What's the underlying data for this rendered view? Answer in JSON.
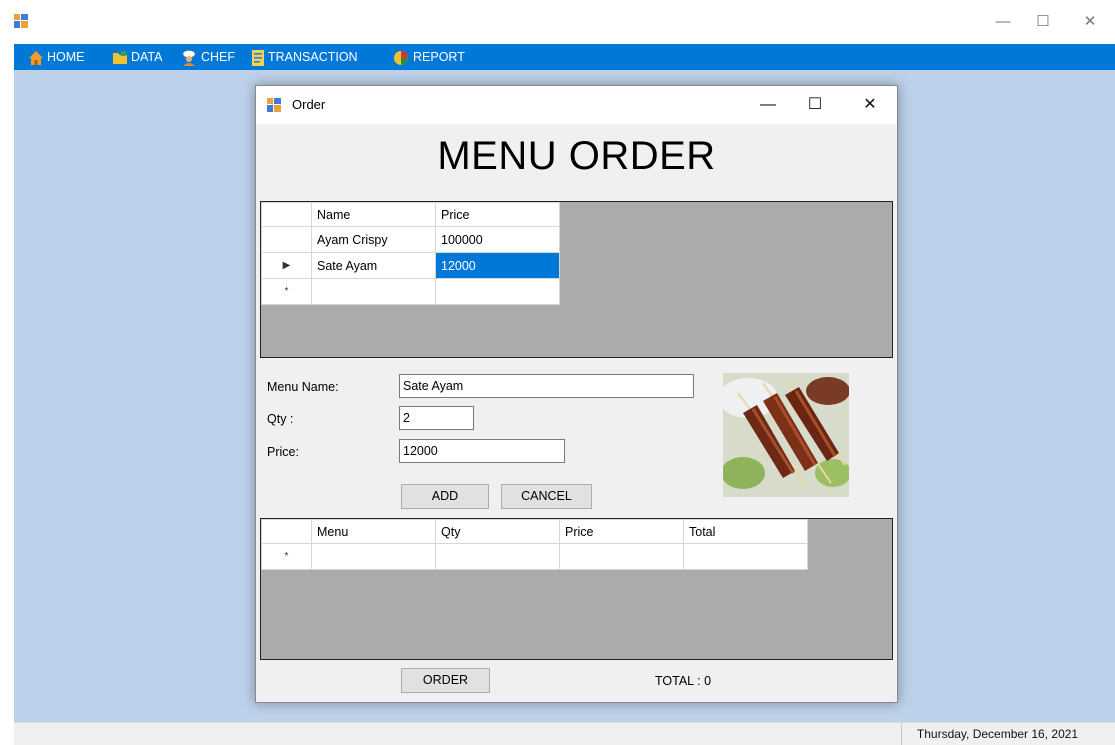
{
  "main_window": {
    "minimize_glyph": "—",
    "maximize_glyph": "☐",
    "close_glyph": "✕"
  },
  "menubar": {
    "items": [
      {
        "label": "HOME",
        "icon": "home-icon"
      },
      {
        "label": "DATA",
        "icon": "folder-icon"
      },
      {
        "label": "CHEF",
        "icon": "chef-icon"
      },
      {
        "label": "TRANSACTION",
        "icon": "transaction-icon"
      },
      {
        "label": "REPORT",
        "icon": "report-icon"
      }
    ]
  },
  "order_window": {
    "title": "Order",
    "minimize_glyph": "—",
    "maximize_glyph": "☐",
    "close_glyph": "✕",
    "heading": "MENU ORDER",
    "menu_grid": {
      "columns": [
        "Name",
        "Price"
      ],
      "rows": [
        {
          "marker": "",
          "name": "Ayam Crispy",
          "price": "100000"
        },
        {
          "marker": "▶",
          "name": "Sate Ayam",
          "price": "12000"
        }
      ],
      "new_row_marker": "*"
    },
    "form": {
      "menu_name_label": "Menu Name:",
      "menu_name_value": "Sate Ayam",
      "qty_label": "Qty :",
      "qty_value": "2",
      "price_label": "Price:",
      "price_value": "12000"
    },
    "add_button": "ADD",
    "cancel_button": "CANCEL",
    "order_grid": {
      "columns": [
        "Menu",
        "Qty",
        "Price",
        "Total"
      ],
      "new_row_marker": "*"
    },
    "order_button": "ORDER",
    "total_text": "TOTAL : 0"
  },
  "status_bar": {
    "date": "Thursday, December 16, 2021"
  },
  "colors": {
    "menubar": "#0078d7",
    "mdi_background": "#bdd1ea",
    "grid_background": "#ababab",
    "selection": "#0078d7"
  }
}
